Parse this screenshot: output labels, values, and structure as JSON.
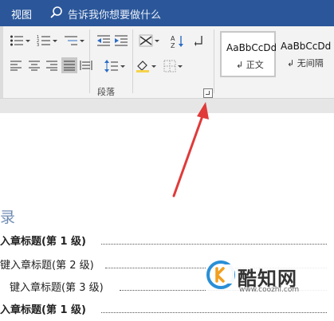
{
  "titlebar": {
    "tab_label": "视图",
    "search_icon": "search-icon",
    "tell_me": "告诉我你想要做什么"
  },
  "ribbon": {
    "paragraph_group_label": "段落",
    "launcher_icon": "dialog-launcher-icon",
    "paragraph_buttons": [
      "bullets-icon",
      "numbering-icon",
      "multilevel-list-icon",
      "decrease-indent-icon",
      "increase-indent-icon",
      "chinese-layout-icon",
      "sort-icon",
      "show-marks-icon",
      "align-left-icon",
      "align-center-icon",
      "align-right-icon",
      "justify-icon",
      "distributed-icon",
      "line-spacing-icon",
      "shading-icon",
      "borders-icon"
    ],
    "styles": [
      {
        "sample": "AaBbCcDd",
        "name": "正文",
        "marker": "↲"
      },
      {
        "sample": "AaBbCcDd",
        "name": "无间隔",
        "marker": "↲"
      }
    ]
  },
  "document": {
    "toc_title": "录",
    "toc_entries": [
      {
        "text": "入章标题(第 1 级)",
        "bold": true
      },
      {
        "text": "键入章标题(第 2 级)",
        "bold": false
      },
      {
        "text": "键入章标题(第 3 级)",
        "bold": false
      },
      {
        "text": "入章标题(第 1 级)",
        "bold": true
      }
    ]
  },
  "annotation": {
    "arrow_color": "#e03a3a"
  },
  "watermark": {
    "name": "酷知网",
    "url": "www.coozhi.com",
    "logo_color": "#2a8fd6"
  },
  "colors": {
    "title_bar": "#2b579a",
    "ribbon_bg": "#f3f3f3",
    "toc_title": "#6f8cb3"
  }
}
